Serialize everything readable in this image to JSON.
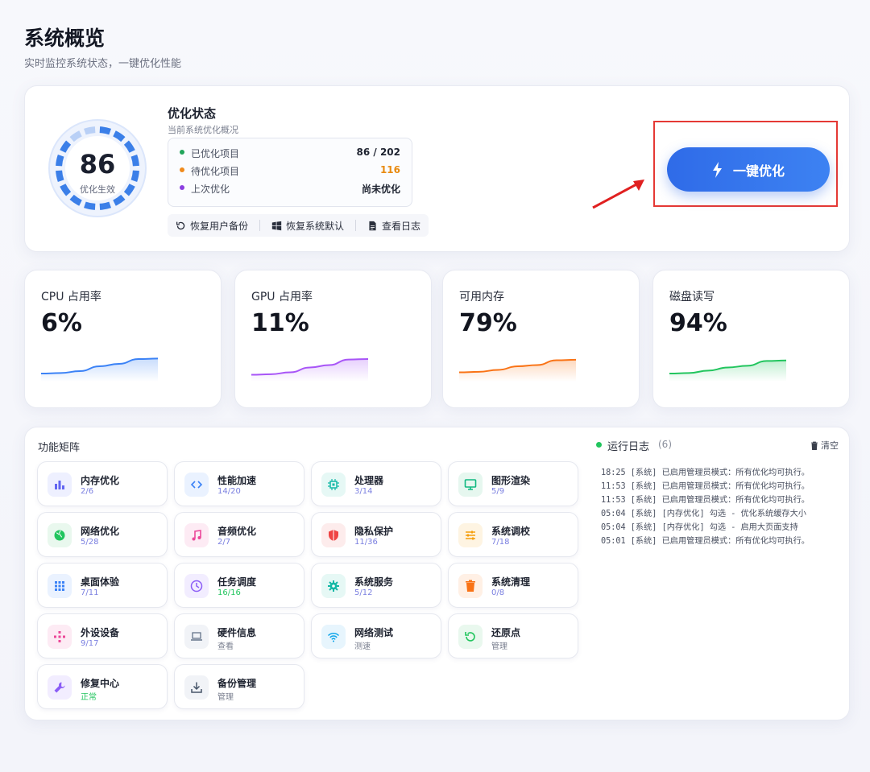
{
  "header": {
    "title": "系统概览",
    "subtitle": "实时监控系统状态，一键优化性能"
  },
  "status": {
    "score": "86",
    "score_fraction": 0.86,
    "score_label": "优化生效",
    "title": "优化状态",
    "subtitle": "当前系统优化概况",
    "rows": [
      {
        "label": "已优化项目",
        "value": "86 / 202",
        "dot_color": "#22a55a",
        "value_color": "#1e2330"
      },
      {
        "label": "待优化项目",
        "value": "116",
        "dot_color": "#f08a1c",
        "value_color": "#e88a10"
      },
      {
        "label": "上次优化",
        "value": "尚未优化",
        "dot_color": "#8b3ee0",
        "value_color": "#1e2330"
      }
    ],
    "actions": [
      {
        "label": "恢复用户备份",
        "icon": "restore-icon"
      },
      {
        "label": "恢复系统默认",
        "icon": "windows-icon"
      },
      {
        "label": "查看日志",
        "icon": "document-icon"
      }
    ],
    "optimize_button": "一键优化"
  },
  "metrics": [
    {
      "label": "CPU 占用率",
      "value": "6%",
      "color": "#3b82f6",
      "points": [
        0.2,
        0.22,
        0.3,
        0.5,
        0.6,
        0.8,
        0.82
      ]
    },
    {
      "label": "GPU 占用率",
      "value": "11%",
      "color": "#a855f7",
      "points": [
        0.15,
        0.17,
        0.25,
        0.45,
        0.55,
        0.78,
        0.8
      ]
    },
    {
      "label": "可用内存",
      "value": "79%",
      "color": "#f97316",
      "points": [
        0.25,
        0.27,
        0.35,
        0.5,
        0.55,
        0.75,
        0.77
      ]
    },
    {
      "label": "磁盘读写",
      "value": "94%",
      "color": "#22c55e",
      "points": [
        0.2,
        0.22,
        0.32,
        0.45,
        0.52,
        0.72,
        0.74
      ]
    }
  ],
  "matrix": {
    "title": "功能矩阵",
    "items": [
      {
        "name": "内存优化",
        "sub": "2/6",
        "icon": "bar-chart-icon",
        "color": "#6366f1",
        "bg": "#eef0ff"
      },
      {
        "name": "性能加速",
        "sub": "14/20",
        "icon": "code-icon",
        "color": "#3b82f6",
        "bg": "#eaf2ff"
      },
      {
        "name": "处理器",
        "sub": "3/14",
        "icon": "cpu-icon",
        "color": "#14b8a6",
        "bg": "#e6f8f5"
      },
      {
        "name": "图形渲染",
        "sub": "5/9",
        "icon": "monitor-icon",
        "color": "#10b981",
        "bg": "#e6f7ef"
      },
      {
        "name": "网络优化",
        "sub": "5/28",
        "icon": "globe-icon",
        "color": "#22c55e",
        "bg": "#e9f8ee"
      },
      {
        "name": "音频优化",
        "sub": "2/7",
        "icon": "music-icon",
        "color": "#ec4899",
        "bg": "#fdebf4"
      },
      {
        "name": "隐私保护",
        "sub": "11/36",
        "icon": "shield-icon",
        "color": "#ef4444",
        "bg": "#fdecec"
      },
      {
        "name": "系统调校",
        "sub": "7/18",
        "icon": "sliders-icon",
        "color": "#f59e0b",
        "bg": "#fef4e2"
      },
      {
        "name": "桌面体验",
        "sub": "7/11",
        "icon": "grid-icon",
        "color": "#3b82f6",
        "bg": "#eaf2ff"
      },
      {
        "name": "任务调度",
        "sub": "16/16",
        "icon": "clock-icon",
        "color": "#8b5cf6",
        "bg": "#f2edff",
        "sub_color": "#22c55e"
      },
      {
        "name": "系统服务",
        "sub": "5/12",
        "icon": "gear-icon",
        "color": "#14b8a6",
        "bg": "#e6f8f5"
      },
      {
        "name": "系统清理",
        "sub": "0/8",
        "icon": "trash-icon",
        "color": "#f97316",
        "bg": "#fff0e5"
      },
      {
        "name": "外设设备",
        "sub": "9/17",
        "icon": "gamepad-icon",
        "color": "#ec4899",
        "bg": "#fdebf4"
      },
      {
        "name": "硬件信息",
        "sub": "查看",
        "icon": "laptop-icon",
        "color": "#64748b",
        "bg": "#f1f3f7",
        "sub_color": "#7b8090"
      },
      {
        "name": "网络测试",
        "sub": "测速",
        "icon": "wifi-icon",
        "color": "#0ea5e9",
        "bg": "#e7f5fd",
        "sub_color": "#7b8090"
      },
      {
        "name": "还原点",
        "sub": "管理",
        "icon": "restore-icon",
        "color": "#22c55e",
        "bg": "#e9f8ee",
        "sub_color": "#7b8090"
      },
      {
        "name": "修复中心",
        "sub": "正常",
        "icon": "wrench-icon",
        "color": "#8b5cf6",
        "bg": "#f2edff",
        "sub_color": "#22c55e"
      },
      {
        "name": "备份管理",
        "sub": "管理",
        "icon": "download-icon",
        "color": "#475569",
        "bg": "#f1f3f7",
        "sub_color": "#7b8090"
      }
    ]
  },
  "log": {
    "title": "运行日志",
    "count": "(6)",
    "clear_label": "清空",
    "lines": [
      "18:25 [系统] 已启用管理员模式：所有优化均可执行。",
      "11:53 [系统] 已启用管理员模式：所有优化均可执行。",
      "11:53 [系统] 已启用管理员模式：所有优化均可执行。",
      "05:04 [系统] [内存优化] 勾选 - 优化系统缓存大小",
      "05:04 [系统] [内存优化] 勾选 - 启用大页面支持",
      "05:01 [系统] 已启用管理员模式：所有优化均可执行。"
    ]
  }
}
